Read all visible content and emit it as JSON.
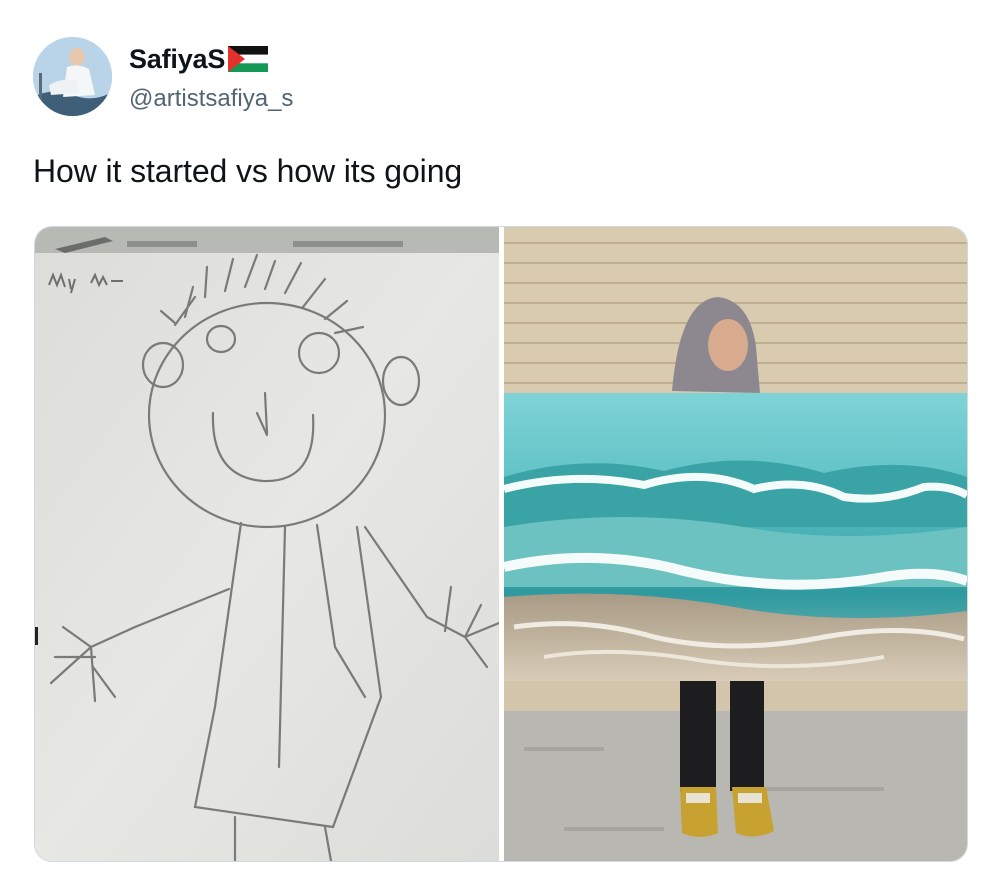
{
  "user": {
    "display_name": "SafiyaS",
    "handle": "@artistsafiya_s",
    "avatar_icon": "profile-photo",
    "flag_icon": "palestine-flag-emoji"
  },
  "tweet": {
    "text": "How it started vs how its going"
  },
  "media": {
    "images": [
      {
        "name": "child-pencil-drawing",
        "caption_on_paper": "My Mum"
      },
      {
        "name": "ocean-wave-painting"
      }
    ]
  },
  "colors": {
    "text_primary": "#0f1419",
    "text_secondary": "#536471",
    "media_border": "#cfd9de"
  }
}
